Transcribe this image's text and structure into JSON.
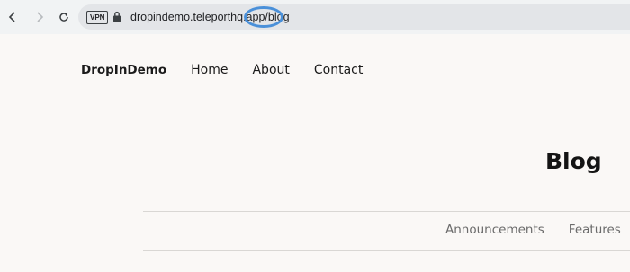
{
  "browser": {
    "back_icon": "chevron-left-icon",
    "forward_icon": "chevron-right-icon",
    "reload_icon": "reload-icon",
    "vpn_label": "VPN",
    "lock_icon": "lock-icon",
    "url": "dropindemo.teleporthq.app/blog",
    "highlight_color": "#4a90d9"
  },
  "site": {
    "brand": "DropInDemo",
    "nav": [
      {
        "label": "Home"
      },
      {
        "label": "About"
      },
      {
        "label": "Contact"
      }
    ]
  },
  "main": {
    "title": "Blog",
    "filters": [
      {
        "label": "Announcements"
      },
      {
        "label": "Features"
      }
    ]
  }
}
